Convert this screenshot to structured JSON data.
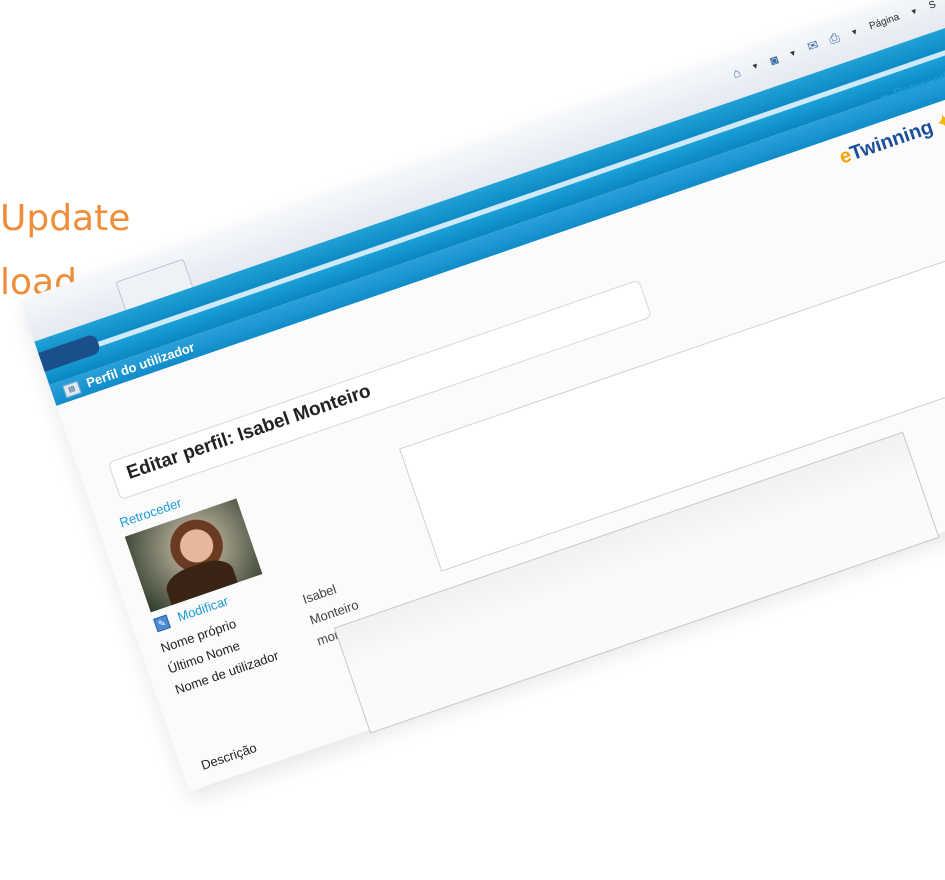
{
  "background": {
    "line1": "Update",
    "line2": "load a"
  },
  "toolbar": {
    "page_label": "Página",
    "s_label": "S"
  },
  "app": {
    "section_title": "Perfil do utilizador",
    "back_top": "Retroceder",
    "logo_text_e": "e",
    "logo_text": "Twinning"
  },
  "profile": {
    "heading": "Editar perfil: Isabel Monteiro",
    "back_label": "Retroceder",
    "modify_label": "Modificar",
    "fields": [
      {
        "label": "Nome próprio",
        "value": "Isabel"
      },
      {
        "label": "Último Nome",
        "value": "Monteiro"
      },
      {
        "label": "Nome de utilizador",
        "value": "monteiro"
      }
    ],
    "description_label": "Descrição"
  },
  "colors": {
    "accent_blue": "#1a9ad6",
    "bar_blue": "#0e8bc6",
    "orange_text": "#ee8e3a"
  }
}
